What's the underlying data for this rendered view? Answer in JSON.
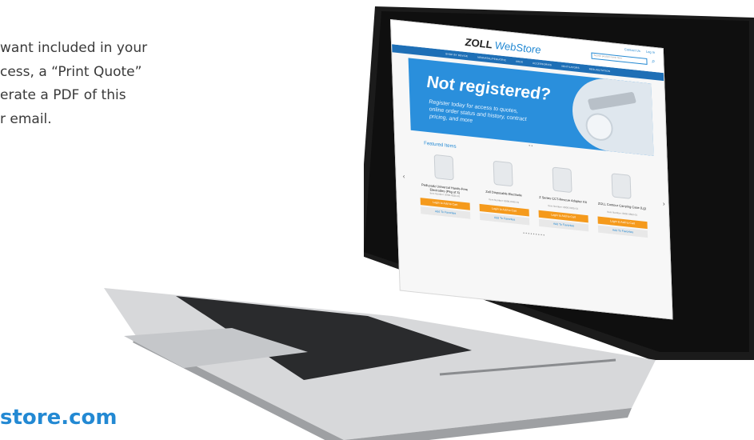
{
  "intro": {
    "line1": "want included in your",
    "line2": "cess, a “Print Quote”",
    "line3": "erate a PDF of this",
    "line4": "r email."
  },
  "footer": {
    "url": "store.com"
  },
  "webstore": {
    "logo_brand": "ZOLL",
    "logo_sub": "WebStore",
    "top_links": [
      "Contact Us",
      "Log In"
    ],
    "search_placeholder": "Search product name here",
    "nav": [
      "SHOP BY DEVICE",
      "NEONATAL/PEDIATRIC",
      "AEDS",
      "ACCESSORIES",
      "VENTILATORS",
      "RESUSCITATION"
    ],
    "banner": {
      "title": "Not registered?",
      "text": "Register today for access to quotes, online order status and history, contract pricing, and more"
    },
    "featured_title": "Featured Items",
    "products": [
      {
        "name": "Pedi-padz Universal Hands-Free Electrodes (Pkg of 3)",
        "number": "Item Number: 8900-0530-01"
      },
      {
        "name": "Zoll Disposable Electrode",
        "number": "Item Number: 8900-0440-01"
      },
      {
        "name": "Z Series CCT-Rescue Adapter Kit",
        "number": "Item Number: 8900-0205-01"
      },
      {
        "name": "ZOLL Contour Carrying Case (Lg)",
        "number": "Item Number: 8000-0850-01"
      }
    ],
    "login_label": "Login to Add to Cart",
    "fav_label": "Add To Favorites",
    "pager": "• • • • • • • • •",
    "colors": {
      "primary": "#2389d3",
      "nav": "#1e6fb6",
      "cta": "#f59a1c"
    }
  }
}
